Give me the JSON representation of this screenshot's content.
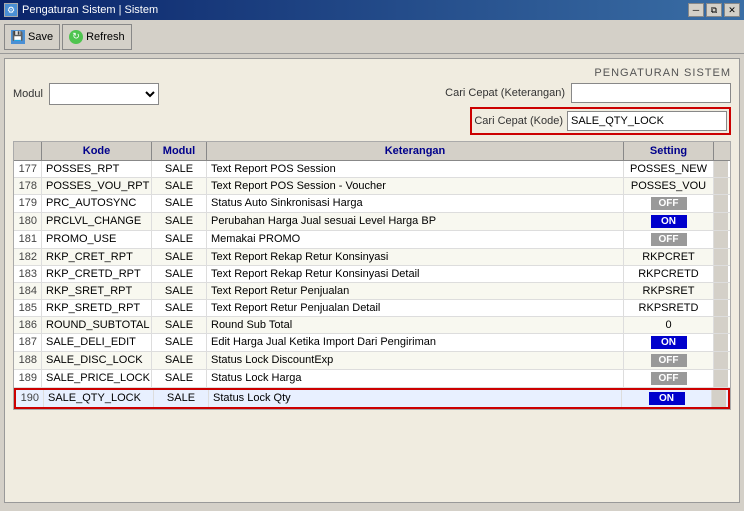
{
  "window": {
    "title": "Pengaturan Sistem | Sistem",
    "controls": {
      "minimize": "─",
      "maximize": "□",
      "restore": "⧉",
      "close": "✕"
    }
  },
  "toolbar": {
    "save_label": "Save",
    "refresh_label": "Refresh"
  },
  "page_header": "PENGATURAN SISTEM",
  "form": {
    "modul_label": "Modul",
    "cari_cepat_label": "Cari Cepat (Keterangan)",
    "cari_kode_label": "Cari Cepat (Kode)",
    "cari_kode_value": "SALE_QTY_LOCK",
    "cari_cepat_value": ""
  },
  "table": {
    "columns": [
      "",
      "Kode",
      "Modul",
      "Keterangan",
      "Setting",
      ""
    ],
    "rows": [
      {
        "num": "177",
        "kode": "POSSES_RPT",
        "modul": "SALE",
        "keterangan": "Text Report POS Session",
        "setting": "text",
        "setting_val": "POSSES_NEW"
      },
      {
        "num": "178",
        "kode": "POSSES_VOU_RPT",
        "modul": "SALE",
        "keterangan": "Text Report POS Session - Voucher",
        "setting": "text",
        "setting_val": "POSSES_VOU"
      },
      {
        "num": "179",
        "kode": "PRC_AUTOSYNC",
        "modul": "SALE",
        "keterangan": "Status Auto Sinkronisasi Harga",
        "setting": "off",
        "setting_val": "OFF"
      },
      {
        "num": "180",
        "kode": "PRCLVL_CHANGE",
        "modul": "SALE",
        "keterangan": "Perubahan Harga Jual sesuai Level Harga BP",
        "setting": "on",
        "setting_val": "ON"
      },
      {
        "num": "181",
        "kode": "PROMO_USE",
        "modul": "SALE",
        "keterangan": "Memakai PROMO",
        "setting": "off",
        "setting_val": "OFF"
      },
      {
        "num": "182",
        "kode": "RKP_CRET_RPT",
        "modul": "SALE",
        "keterangan": "Text Report Rekap Retur Konsinyasi",
        "setting": "text",
        "setting_val": "RKPCRET"
      },
      {
        "num": "183",
        "kode": "RKP_CRETD_RPT",
        "modul": "SALE",
        "keterangan": "Text Report Rekap Retur Konsinyasi Detail",
        "setting": "text",
        "setting_val": "RKPCRETD"
      },
      {
        "num": "184",
        "kode": "RKP_SRET_RPT",
        "modul": "SALE",
        "keterangan": "Text Report Retur Penjualan",
        "setting": "text",
        "setting_val": "RKPSRET"
      },
      {
        "num": "185",
        "kode": "RKP_SRETD_RPT",
        "modul": "SALE",
        "keterangan": "Text Report Retur Penjualan Detail",
        "setting": "text",
        "setting_val": "RKPSRETD"
      },
      {
        "num": "186",
        "kode": "ROUND_SUBTOTAL",
        "modul": "SALE",
        "keterangan": "Round Sub Total",
        "setting": "text",
        "setting_val": "0"
      },
      {
        "num": "187",
        "kode": "SALE_DELI_EDIT",
        "modul": "SALE",
        "keterangan": "Edit Harga Jual Ketika Import Dari Pengiriman",
        "setting": "on",
        "setting_val": "ON"
      },
      {
        "num": "188",
        "kode": "SALE_DISC_LOCK",
        "modul": "SALE",
        "keterangan": "Status Lock DiscountExp",
        "setting": "off",
        "setting_val": "OFF"
      },
      {
        "num": "189",
        "kode": "SALE_PRICE_LOCK",
        "modul": "SALE",
        "keterangan": "Status Lock Harga",
        "setting": "off",
        "setting_val": "OFF"
      },
      {
        "num": "190",
        "kode": "SALE_QTY_LOCK",
        "modul": "SALE",
        "keterangan": "Status Lock Qty",
        "setting": "on",
        "setting_val": "ON"
      }
    ]
  }
}
